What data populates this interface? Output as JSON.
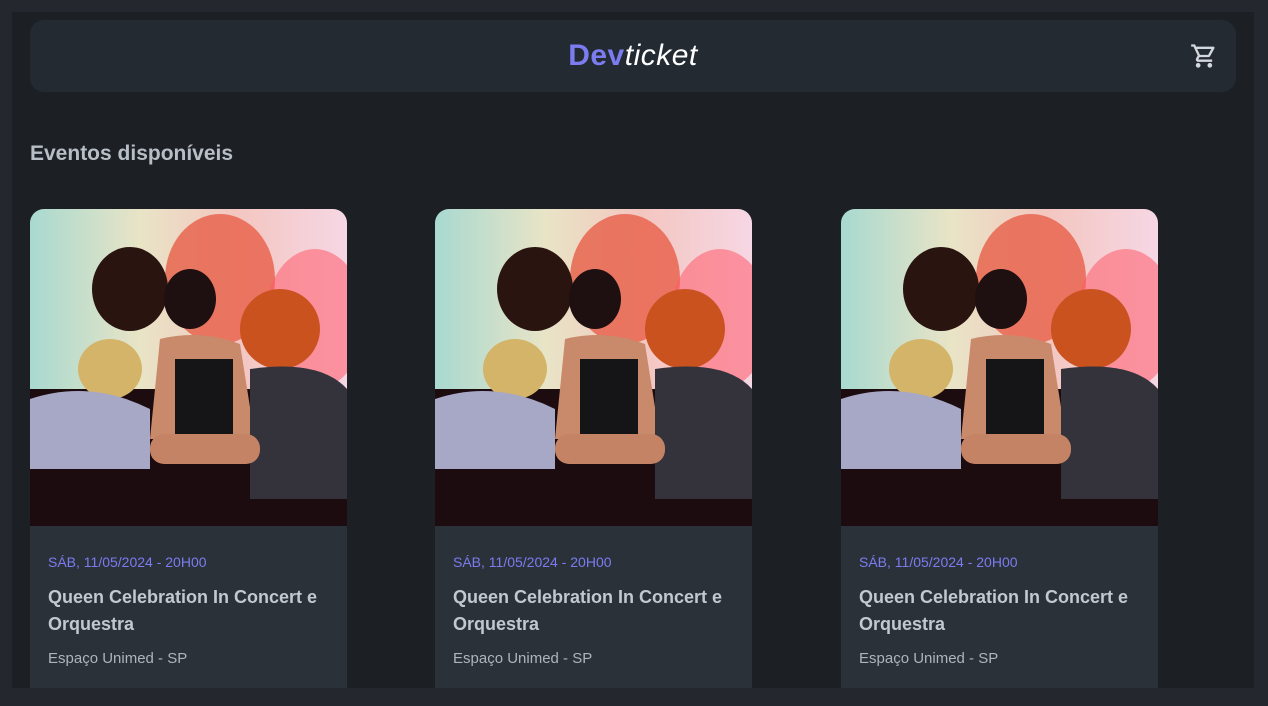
{
  "header": {
    "logo_primary": "Dev",
    "logo_secondary": "ticket",
    "cart_icon": "cart-icon"
  },
  "section": {
    "title": "Eventos disponíveis"
  },
  "events": [
    {
      "date": "SÁB, 11/05/2024 - 20H00",
      "title": "Queen Celebration In Concert e Orquestra",
      "venue": "Espaço Unimed - SP"
    },
    {
      "date": "SÁB, 11/05/2024 - 20H00",
      "title": "Queen Celebration In Concert e Orquestra",
      "venue": "Espaço Unimed - SP"
    },
    {
      "date": "SÁB, 11/05/2024 - 20H00",
      "title": "Queen Celebration In Concert e Orquestra",
      "venue": "Espaço Unimed - SP"
    }
  ],
  "colors": {
    "accent": "#7b7cf0",
    "background": "#1c2025",
    "card": "#2a3139"
  }
}
